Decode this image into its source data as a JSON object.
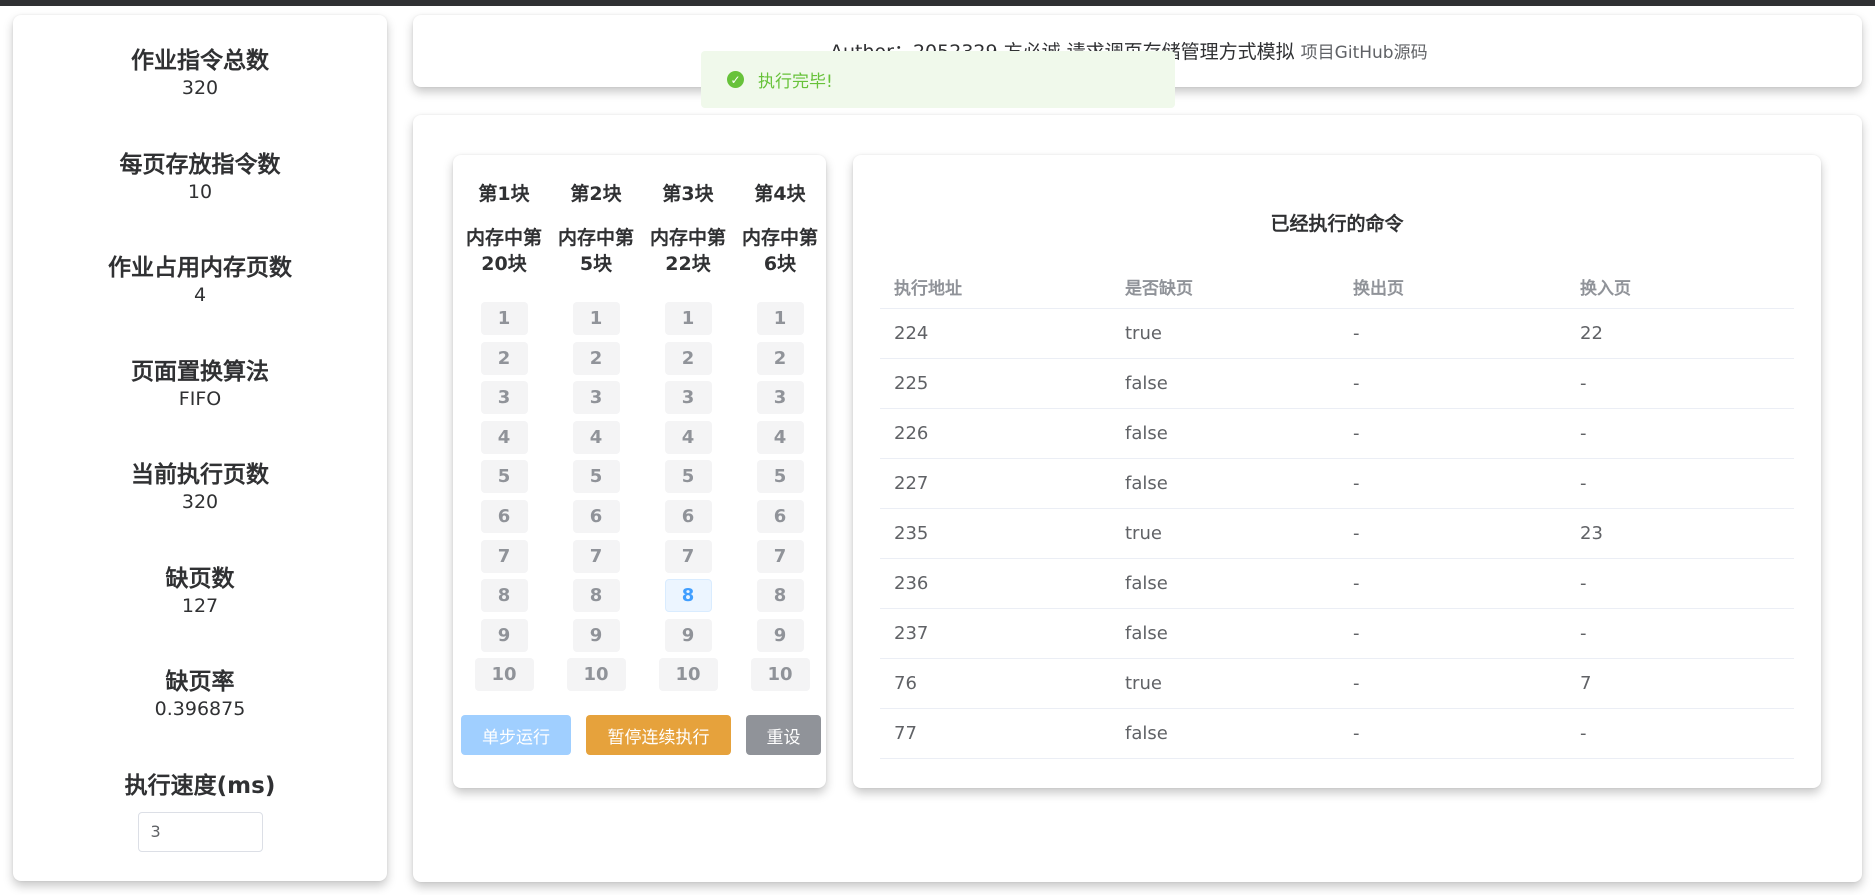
{
  "stats": [
    {
      "label": "作业指令总数",
      "value": "320"
    },
    {
      "label": "每页存放指令数",
      "value": "10"
    },
    {
      "label": "作业占用内存页数",
      "value": "4"
    },
    {
      "label": "页面置换算法",
      "value": "FIFO"
    },
    {
      "label": "当前执行页数",
      "value": "320"
    },
    {
      "label": "缺页数",
      "value": "127"
    },
    {
      "label": "缺页率",
      "value": "0.396875"
    },
    {
      "label": "执行速度(ms)",
      "value": ""
    }
  ],
  "speed_input_value": "3",
  "header": {
    "author": "Author：2052329 方必诚 请求调页存储管理方式模拟",
    "github_link": "项目GitHub源码"
  },
  "toast": {
    "icon": "check-circle",
    "message": "执行完毕!"
  },
  "blocks": [
    {
      "title": "第1块",
      "memory": "内存中第20块"
    },
    {
      "title": "第2块",
      "memory": "内存中第5块"
    },
    {
      "title": "第3块",
      "memory": "内存中第22块"
    },
    {
      "title": "第4块",
      "memory": "内存中第6块"
    }
  ],
  "slots": [
    "1",
    "2",
    "3",
    "4",
    "5",
    "6",
    "7",
    "8",
    "9",
    "10"
  ],
  "active_slot": {
    "block": 3,
    "slot": "8"
  },
  "buttons": {
    "step": "单步运行",
    "pause": "暂停连续执行",
    "reset": "重设"
  },
  "button_colors": {
    "step": "#a0cfff",
    "pause": "#e6a23c",
    "reset": "#909399"
  },
  "executed": {
    "title": "已经执行的命令",
    "headers": [
      "执行地址",
      "是否缺页",
      "换出页",
      "换入页"
    ],
    "rows": [
      [
        "224",
        "true",
        "-",
        "22"
      ],
      [
        "225",
        "false",
        "-",
        "-"
      ],
      [
        "226",
        "false",
        "-",
        "-"
      ],
      [
        "227",
        "false",
        "-",
        "-"
      ],
      [
        "235",
        "true",
        "-",
        "23"
      ],
      [
        "236",
        "false",
        "-",
        "-"
      ],
      [
        "237",
        "false",
        "-",
        "-"
      ],
      [
        "76",
        "true",
        "-",
        "7"
      ],
      [
        "77",
        "false",
        "-",
        "-"
      ]
    ]
  }
}
